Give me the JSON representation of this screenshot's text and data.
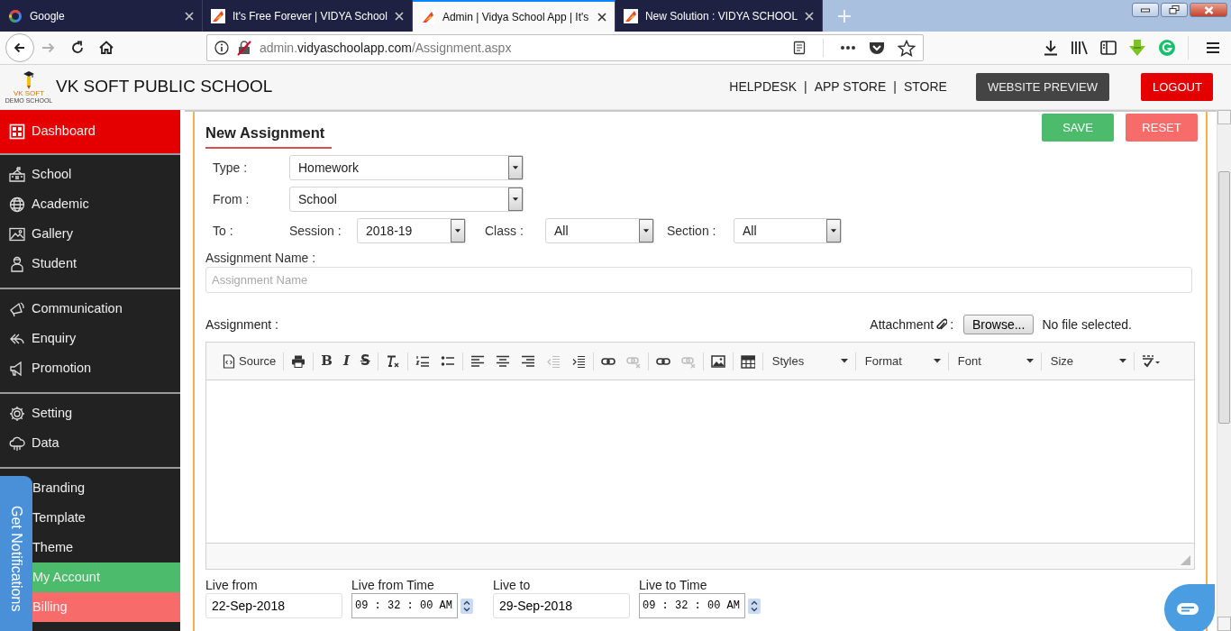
{
  "browser": {
    "tabs": [
      {
        "title": "Google",
        "kind": "search",
        "selected": false
      },
      {
        "title": "It's Free Forever | VIDYA School",
        "kind": "site",
        "selected": false
      },
      {
        "title": "Admin | Vidya School App | It's",
        "kind": "site",
        "selected": true
      },
      {
        "title": "New Solution : VIDYA SCHOOL",
        "kind": "site",
        "selected": false
      }
    ],
    "nav_buttons": [
      {
        "kind": "back",
        "disabled": false
      },
      {
        "kind": "forward",
        "disabled": true
      },
      {
        "kind": "reload",
        "disabled": false
      },
      {
        "kind": "home",
        "disabled": false
      }
    ],
    "url": {
      "subdomain": "admin.",
      "domain": "vidyaschoolapp.com",
      "path": "/Assignment.aspx"
    }
  },
  "app_header": {
    "logo_lines": [
      "VK SOFT",
      "DEMO SCHOOL"
    ],
    "school_name": "VK SOFT PUBLIC SCHOOL",
    "links": [
      "HELPDESK",
      "APP STORE",
      "STORE"
    ],
    "separator": "|",
    "buttons": [
      {
        "label": "WEBSITE PREVIEW",
        "kind": "dark"
      },
      {
        "label": "LOGOUT",
        "kind": "danger"
      }
    ]
  },
  "sidebar": {
    "groups": [
      {
        "items": [
          {
            "label": "Dashboard",
            "color": "#e50000"
          }
        ]
      },
      {
        "items": [
          {
            "label": "School"
          },
          {
            "label": "Academic"
          },
          {
            "label": "Gallery"
          },
          {
            "label": "Student"
          }
        ]
      },
      {
        "items": [
          {
            "label": "Communication"
          },
          {
            "label": "Enquiry"
          },
          {
            "label": "Promotion"
          }
        ]
      },
      {
        "items": [
          {
            "label": "Setting"
          },
          {
            "label": "Data"
          }
        ]
      },
      {
        "items": [
          {
            "label": "Branding"
          },
          {
            "label": "Template"
          },
          {
            "label": "Theme"
          },
          {
            "label": "My Account",
            "color": "#4cbb6c"
          },
          {
            "label": "Billing",
            "color": "#f76b6b"
          }
        ]
      }
    ]
  },
  "notification_tab": {
    "label": "Get Notifications"
  },
  "form": {
    "title": "New Assignment",
    "actions": [
      {
        "label": "SAVE",
        "kind": "save"
      },
      {
        "label": "RESET",
        "kind": "reset"
      }
    ],
    "type": {
      "label": "Type :",
      "value": "Homework"
    },
    "from": {
      "label": "From :",
      "value": "School"
    },
    "to": {
      "label": "To :",
      "selects": [
        {
          "label": "Session :",
          "value": "2018-19"
        },
        {
          "label": "Class :",
          "value": "All"
        },
        {
          "label": "Section :",
          "value": "All"
        }
      ]
    },
    "assignment_name": {
      "label": "Assignment Name :",
      "placeholder": "Assignment Name"
    },
    "assignment": {
      "label": "Assignment :",
      "attachment_label": "Attachment",
      "attachment_suffix": ":",
      "browse": "Browse...",
      "file_status": "No file selected."
    },
    "editor": {
      "toolbar": [
        [
          {
            "kind": "source",
            "label": "Source",
            "disabled": false
          }
        ],
        [
          {
            "kind": "print",
            "disabled": false
          }
        ],
        [
          {
            "kind": "bold",
            "label": "B",
            "disabled": false
          },
          {
            "kind": "italic",
            "label": "I",
            "disabled": false
          },
          {
            "kind": "strike",
            "label": "S",
            "disabled": false
          }
        ],
        [
          {
            "kind": "clear-format",
            "disabled": false
          }
        ],
        [
          {
            "kind": "numbered-list",
            "disabled": false
          },
          {
            "kind": "bulleted-list",
            "disabled": false
          }
        ],
        [
          {
            "kind": "align-left",
            "disabled": false
          },
          {
            "kind": "align-center",
            "disabled": false
          },
          {
            "kind": "align-right",
            "disabled": false
          },
          {
            "kind": "outdent",
            "disabled": true
          },
          {
            "kind": "indent",
            "disabled": false
          }
        ],
        [
          {
            "kind": "link",
            "disabled": false
          },
          {
            "kind": "unlink",
            "disabled": true
          }
        ],
        [
          {
            "kind": "link",
            "disabled": false
          },
          {
            "kind": "unlink",
            "disabled": true
          }
        ],
        [
          {
            "kind": "image",
            "disabled": false
          }
        ],
        [
          {
            "kind": "table",
            "disabled": false
          }
        ],
        [
          {
            "kind": "combo",
            "label": "Styles",
            "disabled": false
          }
        ],
        [
          {
            "kind": "combo",
            "label": "Format",
            "disabled": false
          }
        ],
        [
          {
            "kind": "combo",
            "label": "Font",
            "disabled": false
          }
        ],
        [
          {
            "kind": "combo",
            "label": "Size",
            "disabled": false
          }
        ],
        [
          {
            "kind": "spellcheck",
            "disabled": false
          }
        ]
      ]
    },
    "schedule": [
      {
        "label": "Live from",
        "kind": "date",
        "value": "22-Sep-2018"
      },
      {
        "label": "Live from Time",
        "kind": "time",
        "value": "09 : 32 : 00 AM"
      },
      {
        "label": "Live to",
        "kind": "date",
        "value": "29-Sep-2018"
      },
      {
        "label": "Live to Time",
        "kind": "time",
        "value": "09 : 32 : 00 AM"
      }
    ]
  }
}
